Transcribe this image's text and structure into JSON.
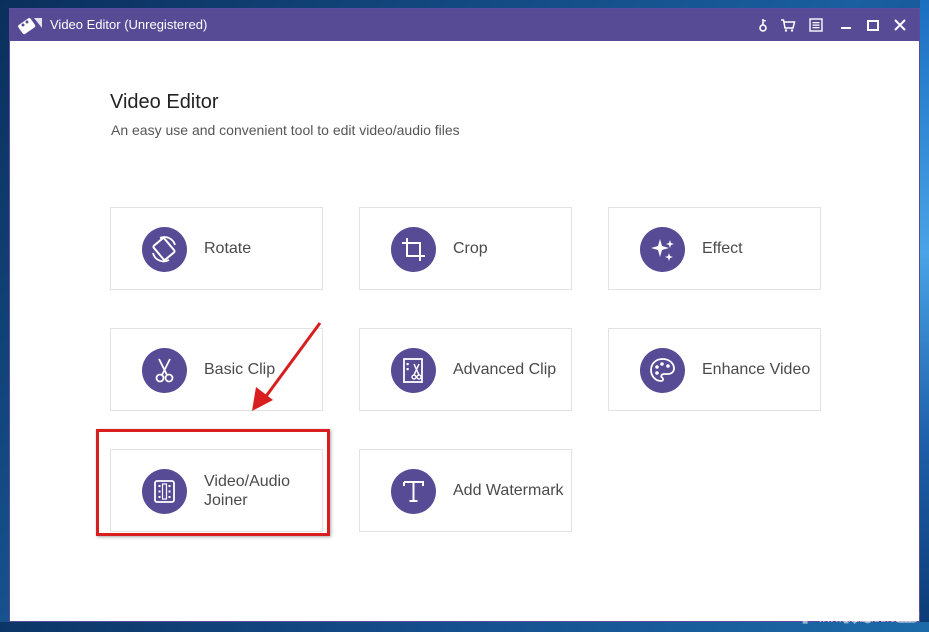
{
  "window": {
    "title": "Video Editor (Unregistered)"
  },
  "toolbar": {
    "icons": [
      "key-icon",
      "cart-icon",
      "menu-icon",
      "minimize-icon",
      "maximize-icon",
      "close-icon"
    ]
  },
  "header": {
    "title": "Video Editor",
    "subtitle": "An easy use and convenient tool to edit video/audio files"
  },
  "tools": [
    {
      "label": "Rotate",
      "icon": "rotate-icon"
    },
    {
      "label": "Crop",
      "icon": "crop-icon"
    },
    {
      "label": "Effect",
      "icon": "effect-icon"
    },
    {
      "label": "Basic Clip",
      "icon": "scissors-icon"
    },
    {
      "label": "Advanced Clip",
      "icon": "advanced-clip-icon"
    },
    {
      "label": "Enhance Video",
      "icon": "palette-icon"
    },
    {
      "label": "Video/Audio Joiner",
      "icon": "joiner-icon"
    },
    {
      "label": "Add Watermark",
      "icon": "text-t-icon"
    }
  ],
  "colors": {
    "accent": "#574b96",
    "annotation": "#d81e1e"
  },
  "watermark": {
    "text": "下载吧",
    "url_text": "www.xiazaiba.com"
  }
}
